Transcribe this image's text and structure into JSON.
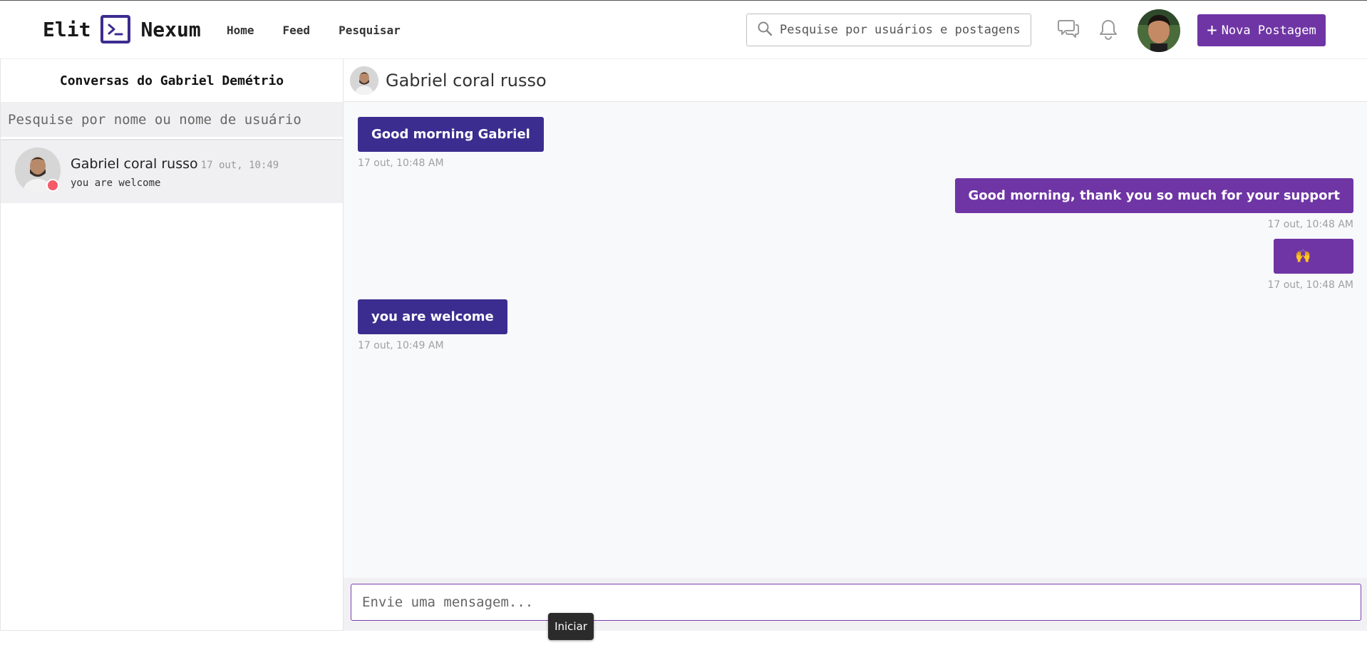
{
  "navbar": {
    "logo_left": "Elit",
    "logo_right": "Nexum",
    "links": [
      "Home",
      "Feed",
      "Pesquisar"
    ],
    "search_placeholder": "Pesquise por usuários e postagens",
    "new_post_label": "Nova Postagem",
    "icons": [
      "search-icon",
      "chat-icon",
      "bell-icon"
    ]
  },
  "sidebar": {
    "title": "Conversas do Gabriel Demétrio",
    "search_placeholder": "Pesquise por nome ou nome de usuário",
    "conversations": [
      {
        "name": "Gabriel coral russo",
        "time": "17 out, 10:49",
        "preview": "you are welcome",
        "status_color": "#f45b69"
      }
    ]
  },
  "chat": {
    "contact_name": "Gabriel coral russo",
    "messages": [
      {
        "direction": "in",
        "text": "Good morning Gabriel",
        "time": "17 out, 10:48 AM"
      },
      {
        "direction": "out",
        "text": "Good morning, thank you so much for your support",
        "time": "17 out, 10:48 AM"
      },
      {
        "direction": "out",
        "text": "🙌",
        "time": "17 out, 10:48 AM"
      },
      {
        "direction": "in",
        "text": "you are welcome",
        "time": "17 out, 10:49 AM"
      }
    ],
    "composer_placeholder": "Envie uma mensagem..."
  },
  "tooltip": {
    "text": "Iniciar"
  },
  "colors": {
    "brand_dark": "#3b2d8f",
    "brand_purple": "#6f35a5",
    "status_dot": "#f45b69"
  }
}
